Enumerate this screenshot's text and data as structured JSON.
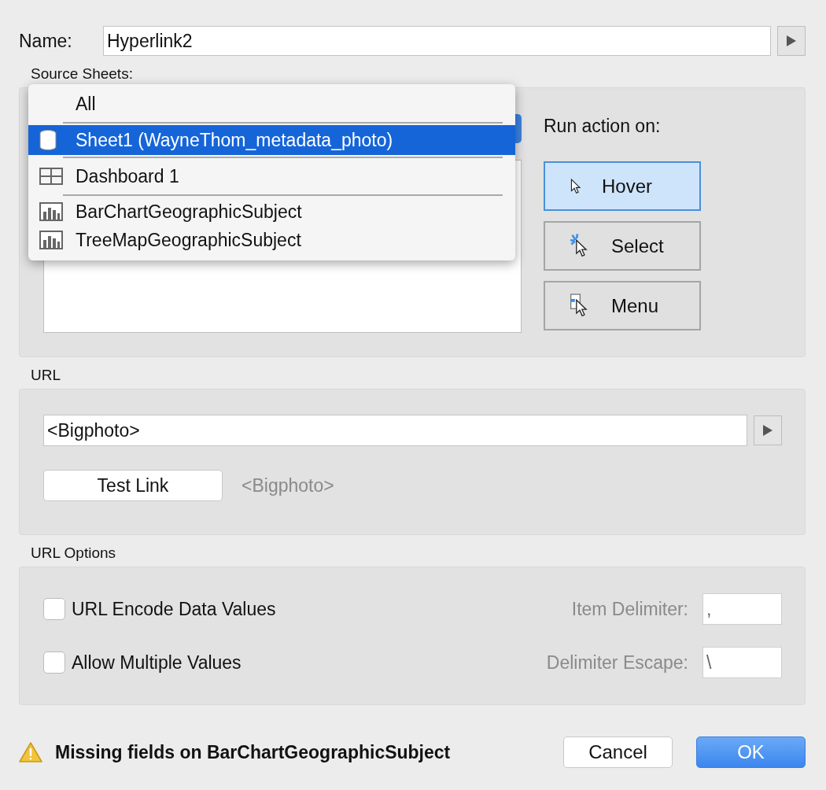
{
  "name": {
    "label": "Name:",
    "value": "Hyperlink2"
  },
  "source_sheets": {
    "label": "Source Sheets:",
    "menu": [
      {
        "kind": "plain",
        "label": "All",
        "selected": false
      },
      {
        "kind": "separator"
      },
      {
        "kind": "datasource",
        "label": "Sheet1 (WayneThom_metadata_photo)",
        "selected": true
      },
      {
        "kind": "separator"
      },
      {
        "kind": "dashboard",
        "label": "Dashboard 1",
        "selected": false
      },
      {
        "kind": "separator"
      },
      {
        "kind": "sheet",
        "label": "BarChartGeographicSubject",
        "selected": false
      },
      {
        "kind": "sheet",
        "label": "TreeMapGeographicSubject",
        "selected": false
      }
    ]
  },
  "run_action": {
    "label": "Run action on:",
    "options": [
      {
        "kind": "hover",
        "label": "Hover",
        "selected": true
      },
      {
        "kind": "select",
        "label": "Select",
        "selected": false
      },
      {
        "kind": "menu",
        "label": "Menu",
        "selected": false
      }
    ]
  },
  "url": {
    "label": "URL",
    "value": "<Bigphoto>",
    "test_button": "Test Link",
    "preview": "<Bigphoto>"
  },
  "url_options": {
    "label": "URL Options",
    "rows": [
      {
        "label": "URL Encode Data Values",
        "checked": false,
        "field_label": "Item Delimiter:",
        "field_value": ","
      },
      {
        "label": "Allow Multiple Values",
        "checked": false,
        "field_label": "Delimiter Escape:",
        "field_value": "\\"
      }
    ]
  },
  "footer": {
    "warning": "Missing fields on BarChartGeographicSubject",
    "buttons": [
      {
        "kind": "secondary",
        "label": "Cancel"
      },
      {
        "kind": "primary",
        "label": "OK"
      }
    ]
  }
}
